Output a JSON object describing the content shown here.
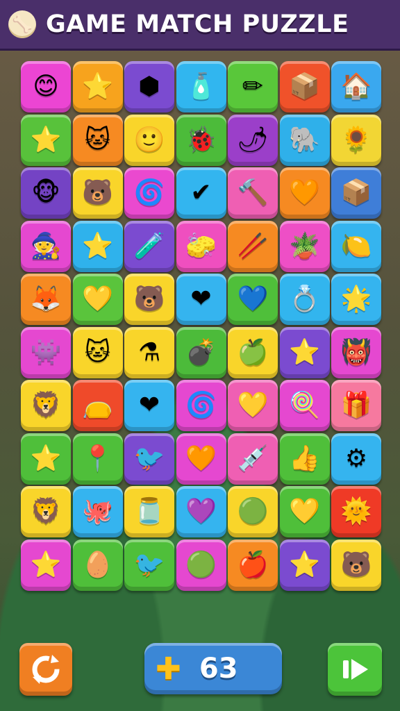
{
  "header": {
    "title": "GAME MATCH PUZZLE",
    "logo_icon": "bone-character-icon"
  },
  "board": {
    "rows": 10,
    "cols": 7,
    "tiles": [
      [
        {
          "color": "#ec45d3",
          "icon": "smiley-face-icon",
          "glyph": "😊"
        },
        {
          "color": "#f7a31d",
          "icon": "pink-star-face-icon",
          "glyph": "⭐"
        },
        {
          "color": "#7b4bd0",
          "icon": "hexagon-gem-icon",
          "glyph": "⬢"
        },
        {
          "color": "#31b6ef",
          "icon": "bottle-icon",
          "glyph": "🧴"
        },
        {
          "color": "#59c73a",
          "icon": "crayon-icon",
          "glyph": "✏"
        },
        {
          "color": "#f0522a",
          "icon": "box-icon",
          "glyph": "📦"
        },
        {
          "color": "#3aa8ef",
          "icon": "house-icon",
          "glyph": "🏠"
        }
      ],
      [
        {
          "color": "#58c23b",
          "icon": "blue-star-icon",
          "glyph": "⭐"
        },
        {
          "color": "#f68a22",
          "icon": "cat-face-icon",
          "glyph": "🐱"
        },
        {
          "color": "#f9d52a",
          "icon": "yellow-smiley-icon",
          "glyph": "🙂"
        },
        {
          "color": "#4cbb3a",
          "icon": "red-bug-icon",
          "glyph": "🐞"
        },
        {
          "color": "#9b3fc9",
          "icon": "chili-pepper-icon",
          "glyph": "🌶"
        },
        {
          "color": "#2fb0ea",
          "icon": "elephant-icon",
          "glyph": "🐘"
        },
        {
          "color": "#f2d634",
          "icon": "sun-flower-icon",
          "glyph": "🌻"
        }
      ],
      [
        {
          "color": "#7443c4",
          "icon": "monkey-face-icon",
          "glyph": "🐵"
        },
        {
          "color": "#f9d52a",
          "icon": "bear-face-icon",
          "glyph": "🐻"
        },
        {
          "color": "#ea49cf",
          "icon": "swirl-planet-icon",
          "glyph": "🌀"
        },
        {
          "color": "#33b5ef",
          "icon": "checkmark-icon",
          "glyph": "✔"
        },
        {
          "color": "#ef5fb3",
          "icon": "hammer-icon",
          "glyph": "🔨"
        },
        {
          "color": "#f68a22",
          "icon": "heart-shield-icon",
          "glyph": "🧡"
        },
        {
          "color": "#3f7ed8",
          "icon": "crate-icon",
          "glyph": "📦"
        }
      ],
      [
        {
          "color": "#e548d0",
          "icon": "wizard-face-icon",
          "glyph": "🧙"
        },
        {
          "color": "#2fb2ec",
          "icon": "yellow-star-icon",
          "glyph": "⭐"
        },
        {
          "color": "#7b4bd0",
          "icon": "potion-bottle-icon",
          "glyph": "🧪"
        },
        {
          "color": "#ef4fbf",
          "icon": "eraser-icon",
          "glyph": "🧽"
        },
        {
          "color": "#f68a22",
          "icon": "chopsticks-icon",
          "glyph": "🥢"
        },
        {
          "color": "#ee4fc6",
          "icon": "flower-pot-icon",
          "glyph": "🪴"
        },
        {
          "color": "#35b4ef",
          "icon": "lemon-icon",
          "glyph": "🍋"
        }
      ],
      [
        {
          "color": "#f68a22",
          "icon": "orange-creature-icon",
          "glyph": "🦊"
        },
        {
          "color": "#5ac43c",
          "icon": "yellow-heart-icon",
          "glyph": "💛"
        },
        {
          "color": "#f9d52a",
          "icon": "bear-smile-icon",
          "glyph": "🐻"
        },
        {
          "color": "#35b4ef",
          "icon": "red-heart-icon",
          "glyph": "❤"
        },
        {
          "color": "#4fbf3a",
          "icon": "blue-heart-icon",
          "glyph": "💙"
        },
        {
          "color": "#32b5ee",
          "icon": "ring-icon",
          "glyph": "💍"
        },
        {
          "color": "#35b4ef",
          "icon": "star-face-icon",
          "glyph": "🌟"
        }
      ],
      [
        {
          "color": "#e548d0",
          "icon": "blue-blob-icon",
          "glyph": "👾"
        },
        {
          "color": "#f9d52a",
          "icon": "orange-cat-icon",
          "glyph": "🐱"
        },
        {
          "color": "#f9d52a",
          "icon": "potion-flask-icon",
          "glyph": "⚗"
        },
        {
          "color": "#4cbb3a",
          "icon": "bomb-icon",
          "glyph": "💣"
        },
        {
          "color": "#f9d52a",
          "icon": "green-apple-icon",
          "glyph": "🍏"
        },
        {
          "color": "#7b4bd0",
          "icon": "orange-star-icon",
          "glyph": "⭐"
        },
        {
          "color": "#e548d0",
          "icon": "orange-monster-icon",
          "glyph": "👹"
        }
      ],
      [
        {
          "color": "#f9d52a",
          "icon": "lion-face-icon",
          "glyph": "🦁"
        },
        {
          "color": "#ef4a2a",
          "icon": "bag-face-icon",
          "glyph": "👝"
        },
        {
          "color": "#35b4ef",
          "icon": "red-heart-icon",
          "glyph": "❤"
        },
        {
          "color": "#e548d0",
          "icon": "spiral-icon",
          "glyph": "🌀"
        },
        {
          "color": "#ef5fb3",
          "icon": "yellow-heart-icon",
          "glyph": "💛"
        },
        {
          "color": "#e548d0",
          "icon": "lollipop-icon",
          "glyph": "🍭"
        },
        {
          "color": "#f6799f",
          "icon": "treasure-box-icon",
          "glyph": "🎁"
        }
      ],
      [
        {
          "color": "#4fbf3a",
          "icon": "orange-star-face-icon",
          "glyph": "⭐"
        },
        {
          "color": "#4fbf3a",
          "icon": "map-pin-icon",
          "glyph": "📍"
        },
        {
          "color": "#7b4bd0",
          "icon": "pink-bird-icon",
          "glyph": "🐦"
        },
        {
          "color": "#e548d0",
          "icon": "orange-blob-icon",
          "glyph": "🧡"
        },
        {
          "color": "#ef5fb3",
          "icon": "syringe-icon",
          "glyph": "💉"
        },
        {
          "color": "#4fbf3a",
          "icon": "thumbs-up-icon",
          "glyph": "👍"
        },
        {
          "color": "#35b4ef",
          "icon": "orange-gear-icon",
          "glyph": "⚙"
        }
      ],
      [
        {
          "color": "#f9d52a",
          "icon": "lion-smile-icon",
          "glyph": "🦁"
        },
        {
          "color": "#35b4ef",
          "icon": "pink-octopus-icon",
          "glyph": "🐙"
        },
        {
          "color": "#f9d52a",
          "icon": "jar-icon",
          "glyph": "🫙"
        },
        {
          "color": "#35b4ef",
          "icon": "purple-heart-icon",
          "glyph": "💜"
        },
        {
          "color": "#f9d52a",
          "icon": "green-blob-icon",
          "glyph": "🟢"
        },
        {
          "color": "#4fbf3a",
          "icon": "yellow-heart-icon",
          "glyph": "💛"
        },
        {
          "color": "#ef3a26",
          "icon": "sun-face-icon",
          "glyph": "🌞"
        }
      ],
      [
        {
          "color": "#e548d0",
          "icon": "purple-star-icon",
          "glyph": "⭐"
        },
        {
          "color": "#4fbf3a",
          "icon": "yellow-egg-face-icon",
          "glyph": "🥚"
        },
        {
          "color": "#4fbf3a",
          "icon": "red-bird-icon",
          "glyph": "🐦"
        },
        {
          "color": "#e548d0",
          "icon": "green-ball-icon",
          "glyph": "🟢"
        },
        {
          "color": "#f68a22",
          "icon": "red-fruit-icon",
          "glyph": "🍎"
        },
        {
          "color": "#7b4bd0",
          "icon": "yellow-star-icon",
          "glyph": "⭐"
        },
        {
          "color": "#f9d52a",
          "icon": "orange-bear-icon",
          "glyph": "🐻"
        }
      ]
    ]
  },
  "footer": {
    "reset_icon": "refresh-icon",
    "score_icon": "plus-cross-icon",
    "score_value": "63",
    "next_icon": "play-next-icon"
  }
}
